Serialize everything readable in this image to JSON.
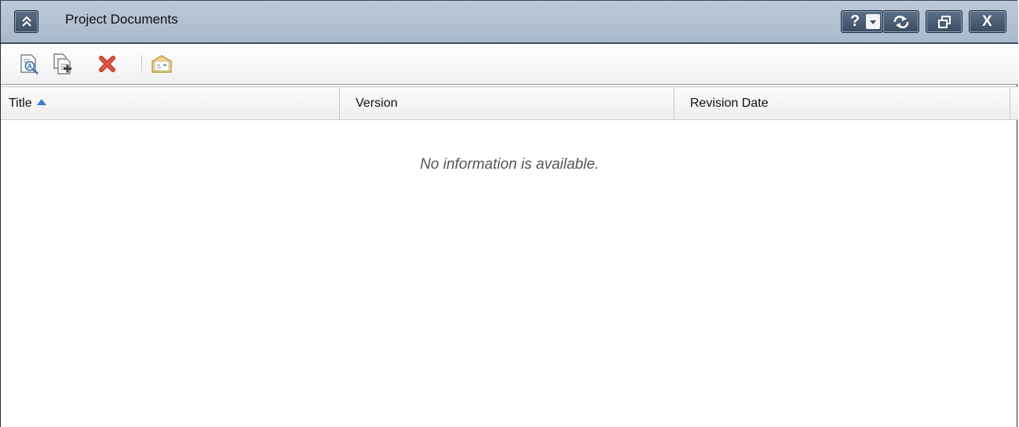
{
  "window": {
    "title": "Project Documents",
    "buttons": {
      "help": "?",
      "menu": "dropdown",
      "refresh": "refresh",
      "restore": "restore",
      "close": "X"
    }
  },
  "toolbar": {
    "items": [
      {
        "icon": "view-document-icon"
      },
      {
        "icon": "add-document-icon"
      },
      {
        "icon": "delete-icon"
      },
      {
        "icon": "mail-icon"
      }
    ]
  },
  "table": {
    "columns": [
      "Title",
      "Version",
      "Revision Date"
    ],
    "sort_column": "Title",
    "sort_direction": "ascending",
    "empty_message": "No information is available."
  },
  "colors": {
    "titlebar": "#b4c3d4",
    "button_dark": "#3b4d64",
    "sort_arrow": "#3d7fc9"
  }
}
